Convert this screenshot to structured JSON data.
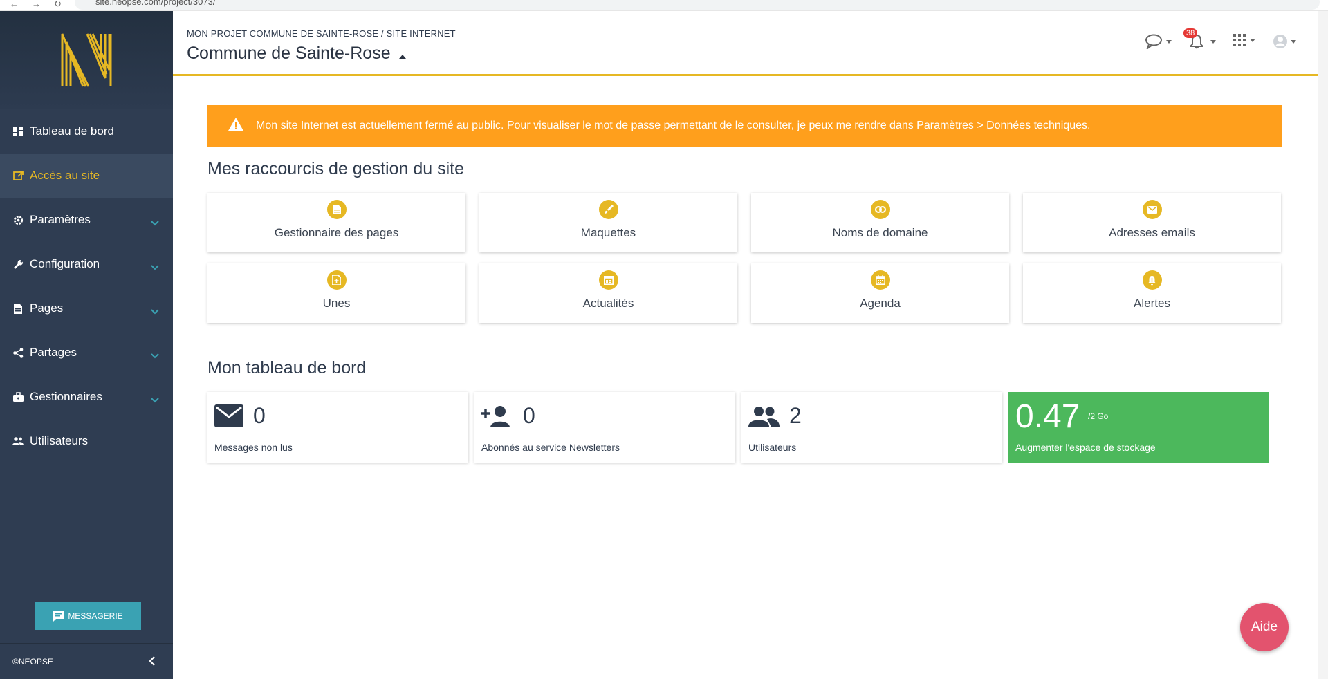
{
  "browser": {
    "url": "site.neopse.com/project/3073/"
  },
  "sidebar": {
    "items": [
      {
        "label": "Tableau de bord",
        "icon": "dashboard-icon",
        "has_children": false
      },
      {
        "label": "Accès au site",
        "icon": "external-link-icon",
        "has_children": false,
        "active": true
      },
      {
        "label": "Paramètres",
        "icon": "gear-icon",
        "has_children": true
      },
      {
        "label": "Configuration",
        "icon": "wrench-icon",
        "has_children": true
      },
      {
        "label": "Pages",
        "icon": "document-icon",
        "has_children": true
      },
      {
        "label": "Partages",
        "icon": "share-icon",
        "has_children": true
      },
      {
        "label": "Gestionnaires",
        "icon": "briefcase-icon",
        "has_children": true
      },
      {
        "label": "Utilisateurs",
        "icon": "users-icon",
        "has_children": false
      }
    ],
    "messaging_label": "MESSAGERIE",
    "footer_label": "©NEOPSE"
  },
  "header": {
    "breadcrumb": "MON PROJET COMMUNE DE SAINTE-ROSE / SITE INTERNET",
    "title": "Commune de Sainte-Rose",
    "notification_count": "38"
  },
  "alert": {
    "text": "Mon site Internet est actuellement fermé au public. Pour visualiser le mot de passe permettant de le consulter, je peux me rendre dans Paramètres > Données techniques."
  },
  "shortcuts": {
    "title": "Mes raccourcis de gestion du site",
    "items": [
      {
        "label": "Gestionnaire des pages",
        "icon": "page-icon"
      },
      {
        "label": "Maquettes",
        "icon": "brush-icon"
      },
      {
        "label": "Noms de domaine",
        "icon": "link-icon"
      },
      {
        "label": "Adresses emails",
        "icon": "mail-icon"
      },
      {
        "label": "Unes",
        "icon": "add-document-icon"
      },
      {
        "label": "Actualités",
        "icon": "news-icon"
      },
      {
        "label": "Agenda",
        "icon": "calendar-icon"
      },
      {
        "label": "Alertes",
        "icon": "bell-alert-icon"
      }
    ]
  },
  "dashboard": {
    "title": "Mon tableau de bord",
    "messages": {
      "value": "0",
      "label": "Messages non lus"
    },
    "subscribers": {
      "value": "0",
      "label": "Abonnés au service Newsletters"
    },
    "users": {
      "value": "2",
      "label": "Utilisateurs"
    },
    "storage": {
      "value": "0.47",
      "unit": "/2 Go",
      "link": "Augmenter l'espace de stockage"
    }
  },
  "help_label": "Aide",
  "colors": {
    "sidebar": "#2f3d52",
    "accent": "#e6b824",
    "alert": "#ff9f1c",
    "storage": "#4cb85c",
    "help": "#e3536e",
    "messaging": "#3aa2b3"
  }
}
